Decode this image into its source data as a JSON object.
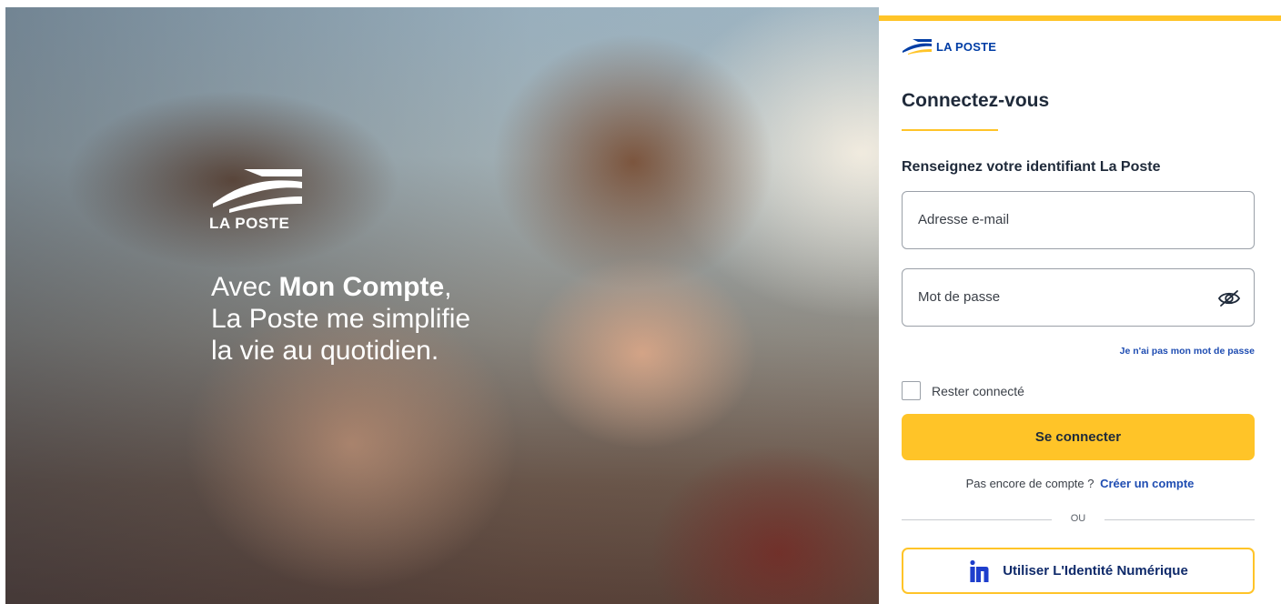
{
  "hero": {
    "logo_text": "LA POSTE",
    "tagline_1_pre": "Avec ",
    "tagline_1_bold": "Mon Compte",
    "tagline_1_post": ",",
    "tagline_2": "La Poste me simplifie",
    "tagline_3": "la vie au quotidien."
  },
  "panel": {
    "brand_text": "LA POSTE",
    "title": "Connectez-vous",
    "subtitle": "Renseignez votre identifiant La Poste",
    "email_placeholder": "Adresse e-mail",
    "password_placeholder": "Mot de passe",
    "forgot_link": "Je n'ai pas mon mot de passe",
    "remember_label": "Rester connecté",
    "submit_label": "Se connecter",
    "signup_text": "Pas encore de compte ?",
    "signup_link": "Créer un compte",
    "or_text": "OU",
    "identity_button": "Utiliser L'Identité Numérique"
  },
  "colors": {
    "accent_yellow": "#ffc428",
    "brand_blue": "#003da5",
    "link_blue": "#1f4db2",
    "text_dark": "#1f2a3a"
  },
  "icons": {
    "brand": "la-poste-logo-icon",
    "password_toggle": "eye-icon",
    "identity": "identite-numerique-icon"
  }
}
